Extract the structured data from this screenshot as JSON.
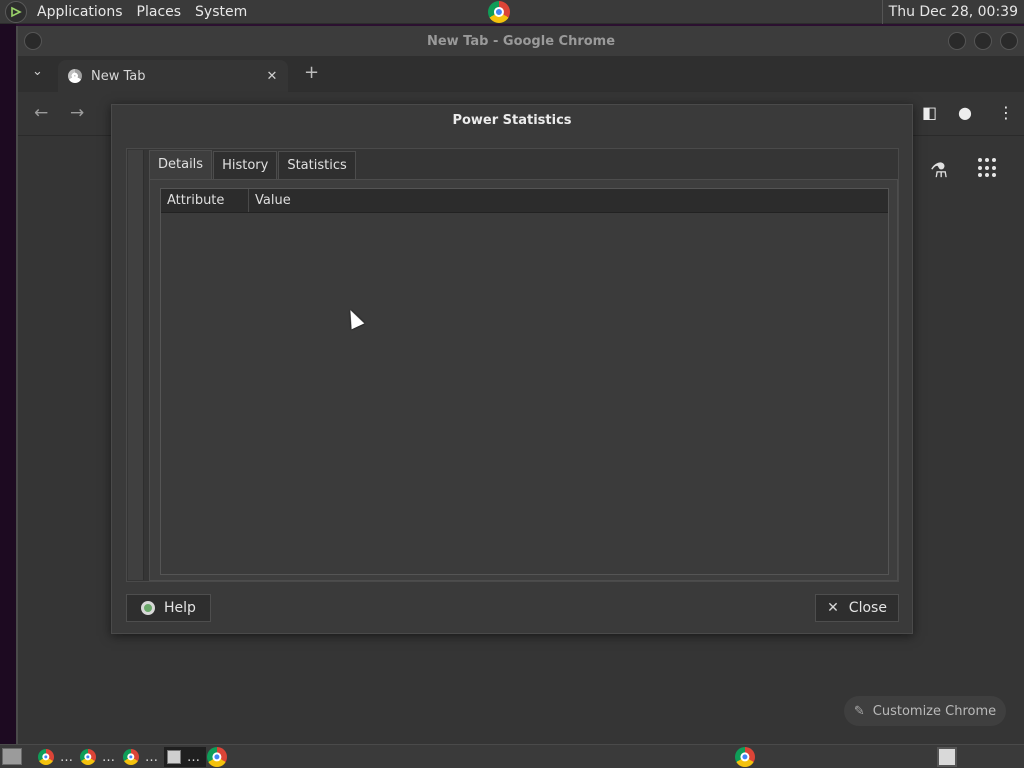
{
  "top_panel": {
    "menus": [
      "Applications",
      "Places",
      "System"
    ],
    "clock": "Thu Dec 28, 00:39"
  },
  "chrome": {
    "window_title": "New Tab - Google Chrome",
    "tab_title": "New Tab",
    "customize_label": "Customize Chrome"
  },
  "dialog": {
    "title": "Power Statistics",
    "tabs": [
      "Details",
      "History",
      "Statistics"
    ],
    "active_tab": "Details",
    "columns": [
      "Attribute",
      "Value"
    ],
    "help_label": "Help",
    "close_label": "Close"
  },
  "taskbar": {
    "ellipsis": "…"
  },
  "icons": {
    "browser": "chrome-icon",
    "help": "lifebuoy-icon",
    "close": "close-icon",
    "labs": "flask-icon",
    "apps": "grid-icon"
  }
}
